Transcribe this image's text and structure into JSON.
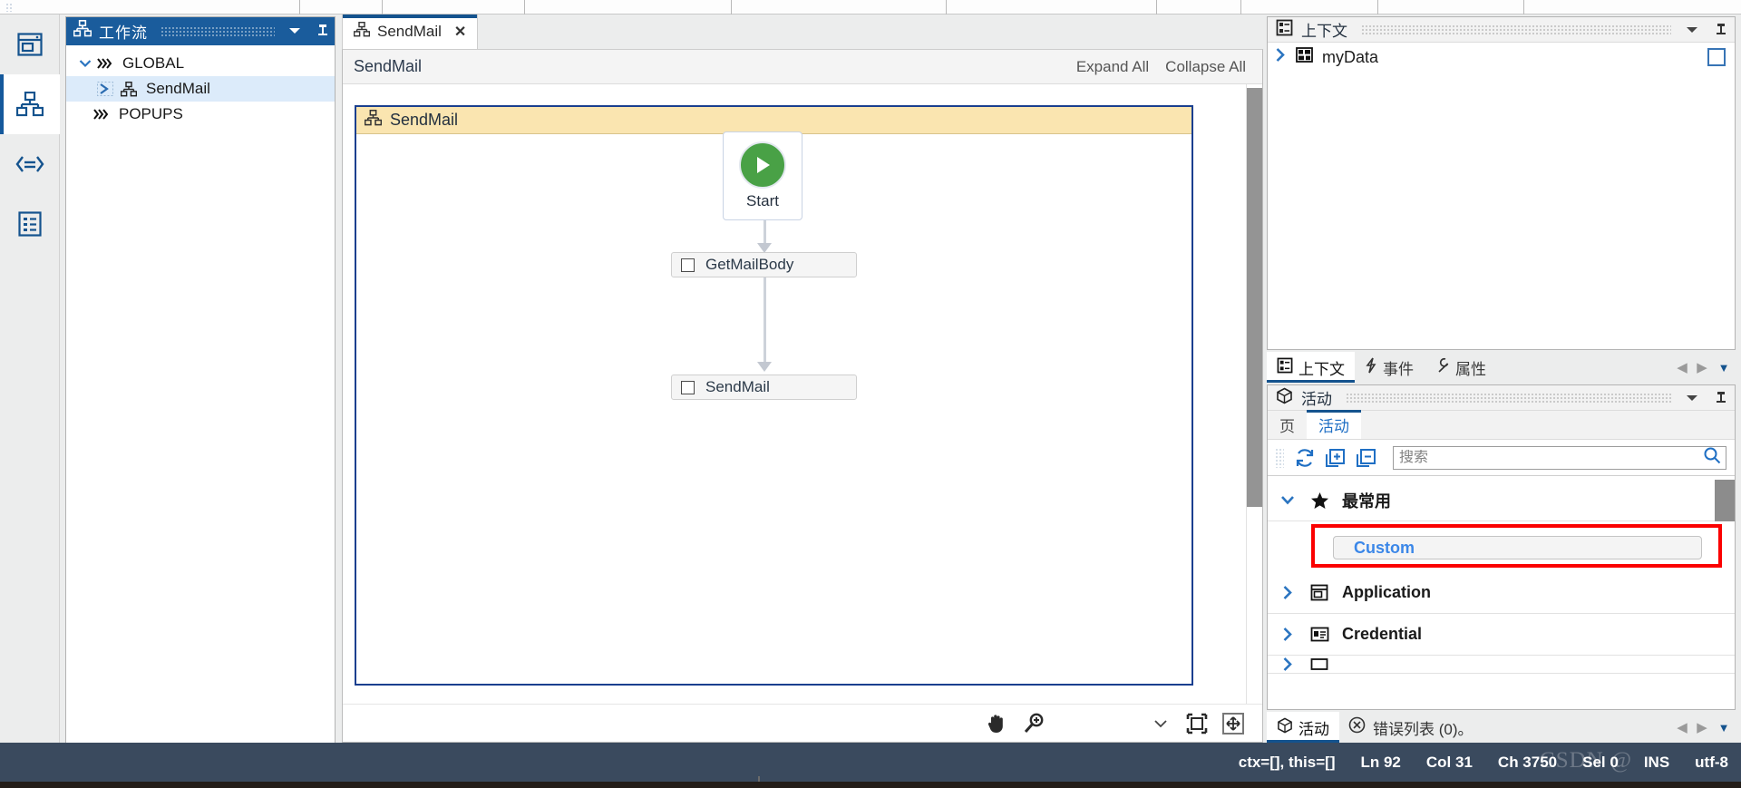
{
  "app": {
    "accent_blue": "#14538e",
    "header_blue": "#1a5c9c",
    "highlight_red": "#fb0000",
    "status_bg": "#3a4a5e"
  },
  "rail": {
    "items": [
      {
        "name": "application-window-icon",
        "label": "Application"
      },
      {
        "name": "workflow-icon",
        "label": "Workflow",
        "active": true
      },
      {
        "name": "script-icon",
        "label": "Script"
      },
      {
        "name": "list-icon",
        "label": "List"
      }
    ]
  },
  "workflow_panel": {
    "title": "工作流",
    "icon": "workflow-icon",
    "dropdown_icon": "chevron-down-icon",
    "pin_icon": "pin-icon",
    "tree": [
      {
        "label": "GLOBAL",
        "icon": "chevrons-right-icon",
        "expanded": true,
        "level": 1,
        "selected": false
      },
      {
        "label": "SendMail",
        "icon": "workflow-icon",
        "level": 2,
        "selected": true
      },
      {
        "label": "POPUPS",
        "icon": "chevrons-right-icon",
        "expanded": false,
        "level": 1,
        "selected": false
      }
    ]
  },
  "editor": {
    "tab": {
      "label": "SendMail",
      "icon": "workflow-icon",
      "close_icon": "close-icon"
    },
    "header": {
      "name": "SendMail",
      "expand_all": "Expand All",
      "collapse_all": "Collapse All"
    },
    "diagram": {
      "title": "SendMail",
      "title_icon": "workflow-icon",
      "start_node": {
        "label": "Start",
        "icon": "play-icon"
      },
      "activities": [
        {
          "label": "GetMailBody",
          "checkbox": false
        },
        {
          "label": "SendMail",
          "checkbox": false
        }
      ]
    },
    "footer_tools": [
      {
        "name": "pan-hand-icon"
      },
      {
        "name": "zoom-in-icon"
      },
      {
        "name": "chevron-down-icon"
      },
      {
        "name": "fit-content-icon"
      },
      {
        "name": "fit-page-icon"
      }
    ]
  },
  "context_panel": {
    "title": "上下文",
    "icon": "context-icon",
    "dropdown_icon": "chevron-down-icon",
    "pin_icon": "pin-icon",
    "items": [
      {
        "label": "myData",
        "icon": "data-grid-icon",
        "expand_icon": "chevron-right-icon",
        "checkbox": false
      }
    ]
  },
  "right_tabs": {
    "items": [
      {
        "label": "上下文",
        "icon": "context-icon",
        "active": true
      },
      {
        "label": "事件",
        "icon": "event-bolt-icon",
        "active": false
      },
      {
        "label": "属性",
        "icon": "properties-wrench-icon",
        "active": false
      }
    ],
    "prev_icon": "chevron-left-icon",
    "next_icon": "chevron-right-icon",
    "dropdown_icon": "chevron-down-icon"
  },
  "activity_panel": {
    "title": "活动",
    "icon": "cube-icon",
    "dropdown_icon": "chevron-down-icon",
    "pin_icon": "pin-icon",
    "subtabs": [
      {
        "label": "页",
        "active": false
      },
      {
        "label": "活动",
        "active": true
      }
    ],
    "tools": [
      {
        "name": "refresh-icon"
      },
      {
        "name": "expand-all-icon"
      },
      {
        "name": "collapse-all-icon"
      }
    ],
    "search": {
      "placeholder": "搜索",
      "value": "",
      "icon": "search-icon"
    },
    "groups": [
      {
        "label": "最常用",
        "icon": "star-icon",
        "expand_icon": "chevron-down-icon",
        "expanded": true,
        "items": [
          {
            "label": "Custom",
            "highlighted": true
          }
        ]
      },
      {
        "label": "Application",
        "icon": "application-icon",
        "expand_icon": "chevron-right-icon",
        "expanded": false,
        "items": []
      },
      {
        "label": "Credential",
        "icon": "credential-card-icon",
        "expand_icon": "chevron-right-icon",
        "expanded": false,
        "items": []
      }
    ]
  },
  "bottom_tabs": {
    "activity_label": "活动",
    "activity_icon": "cube-icon",
    "error_label": "错误列表 (0)。",
    "error_icon": "error-circle-icon",
    "prev_icon": "chevron-left-icon",
    "next_icon": "chevron-right-icon",
    "dropdown_icon": "chevron-down-icon"
  },
  "status_bar": {
    "cells": [
      {
        "name": "context-info",
        "text": "ctx=[], this=[]"
      },
      {
        "name": "line-indicator",
        "text": "Ln 92"
      },
      {
        "name": "column-indicator",
        "text": "Col 31"
      },
      {
        "name": "char-indicator",
        "text": "Ch 3750"
      },
      {
        "name": "selection-indicator",
        "text": "Sel 0"
      },
      {
        "name": "insert-mode-indicator",
        "text": "INS"
      },
      {
        "name": "encoding-indicator",
        "text": "utf-8"
      }
    ],
    "watermark": "CSDN @"
  }
}
